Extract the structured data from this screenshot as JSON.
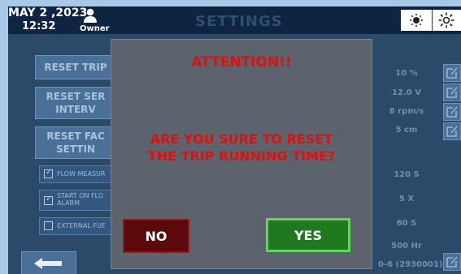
{
  "header": {
    "date": "MAY  2 ,2023",
    "time": "12:32",
    "user_label": "Owner",
    "title": "SETTINGS",
    "user_icon": "user-icon",
    "brightness_low_icon": "brightness-low-icon",
    "brightness_high_icon": "brightness-high-icon"
  },
  "left_buttons": {
    "reset_trip": "RESET TRIP",
    "reset_service_l1": "RESET SER",
    "reset_service_l2": "INTERV",
    "reset_factory_l1": "RESET FAC",
    "reset_factory_l2": "SETTIN"
  },
  "checkboxes": [
    {
      "label": "FLOW MEASUR",
      "checked": true
    },
    {
      "label_l1": "START ON FLO",
      "label_l2": "ALARM",
      "checked": true
    },
    {
      "label": "EXTERNAL FUE",
      "checked": false
    }
  ],
  "values": [
    "10 %",
    "12.0 V",
    "8 rpm/s",
    "5 cm",
    "120 S",
    "5 X",
    "60 S",
    "500 Hr"
  ],
  "sensor": {
    "text": "0-6 (2930001)"
  },
  "dialog": {
    "title": "ATTENTION!!",
    "message_l1": "ARE YOU SURE TO RESET",
    "message_l2": "THE TRIP RUNNING TIME?",
    "no_label": "NO",
    "yes_label": "YES"
  },
  "colors": {
    "screen_bg": "#16324f",
    "dialog_bg": "#5c636c",
    "alert_text": "#e01010",
    "yes_button": "#1f7a1f",
    "no_button": "#5a0a0a"
  }
}
